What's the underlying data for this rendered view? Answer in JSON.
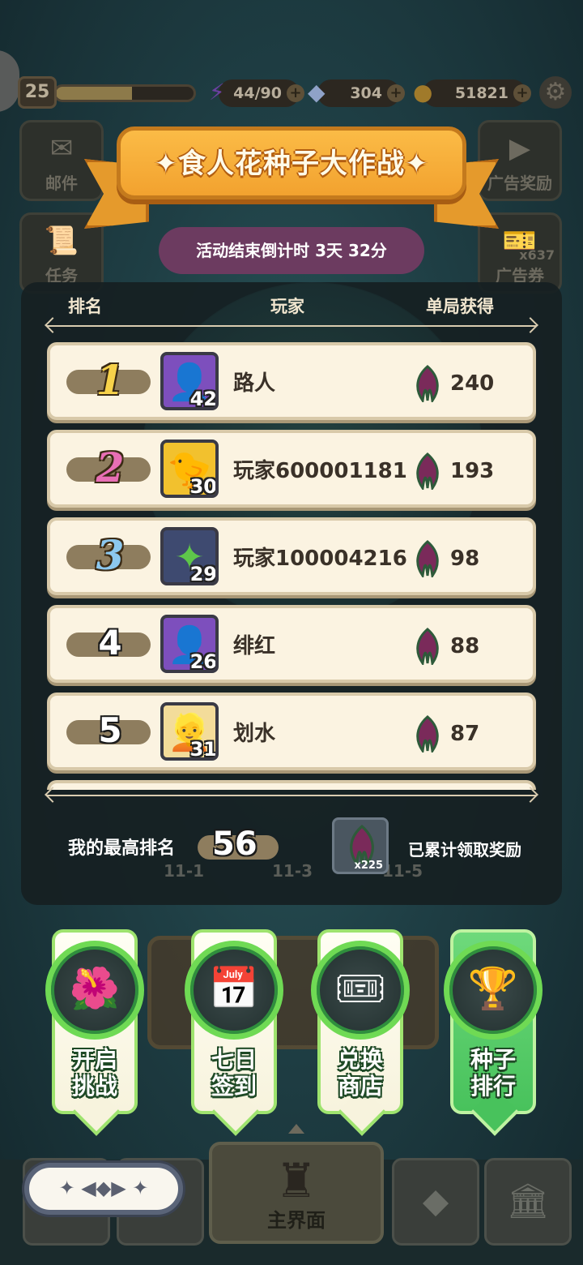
{
  "top_bar": {
    "level": "25",
    "level_progress": 0.55,
    "energy": "44/90",
    "gems": "304",
    "coins": "51821"
  },
  "side_buttons": {
    "mail": "邮件",
    "tasks": "任务",
    "ad_reward": "广告奖励",
    "ad_ticket": "广告券",
    "ad_ticket_count": "x637"
  },
  "event": {
    "title": "✦食人花种子大作战✦",
    "countdown": "活动结束倒计时 3天 32分"
  },
  "columns": {
    "rank": "排名",
    "player": "玩家",
    "score": "单局获得"
  },
  "rankings": [
    {
      "rank": "1",
      "name": "路人",
      "level": "42",
      "score": "240",
      "avatar": "purple-hair-avatar"
    },
    {
      "rank": "2",
      "name": "玩家600001181",
      "level": "30",
      "score": "193",
      "avatar": "yellow-bird-avatar"
    },
    {
      "rank": "3",
      "name": "玩家100004216",
      "level": "29",
      "score": "98",
      "avatar": "green-gem-avatar"
    },
    {
      "rank": "4",
      "name": "绯红",
      "level": "26",
      "score": "88",
      "avatar": "purple-hair-avatar"
    },
    {
      "rank": "5",
      "name": "划水",
      "level": "31",
      "score": "87",
      "avatar": "blonde-hair-avatar"
    }
  ],
  "my_rank": {
    "label": "我的最高排名",
    "value": "56"
  },
  "reward": {
    "count": "x225",
    "label": "已累计领取奖励"
  },
  "faded_stages": [
    "11-1",
    "11-3",
    "11-5"
  ],
  "actions": [
    {
      "label_1": "开启",
      "label_2": "挑战",
      "icon": "carnivorous-plant-icon",
      "active": false
    },
    {
      "label_1": "七日",
      "label_2": "签到",
      "icon": "calendar-icon",
      "active": false
    },
    {
      "label_1": "兑换",
      "label_2": "商店",
      "icon": "seed-ticket-icon",
      "active": false
    },
    {
      "label_1": "种子",
      "label_2": "排行",
      "icon": "trophy-icon",
      "active": true
    }
  ],
  "nav": {
    "main_label": "主界面"
  }
}
